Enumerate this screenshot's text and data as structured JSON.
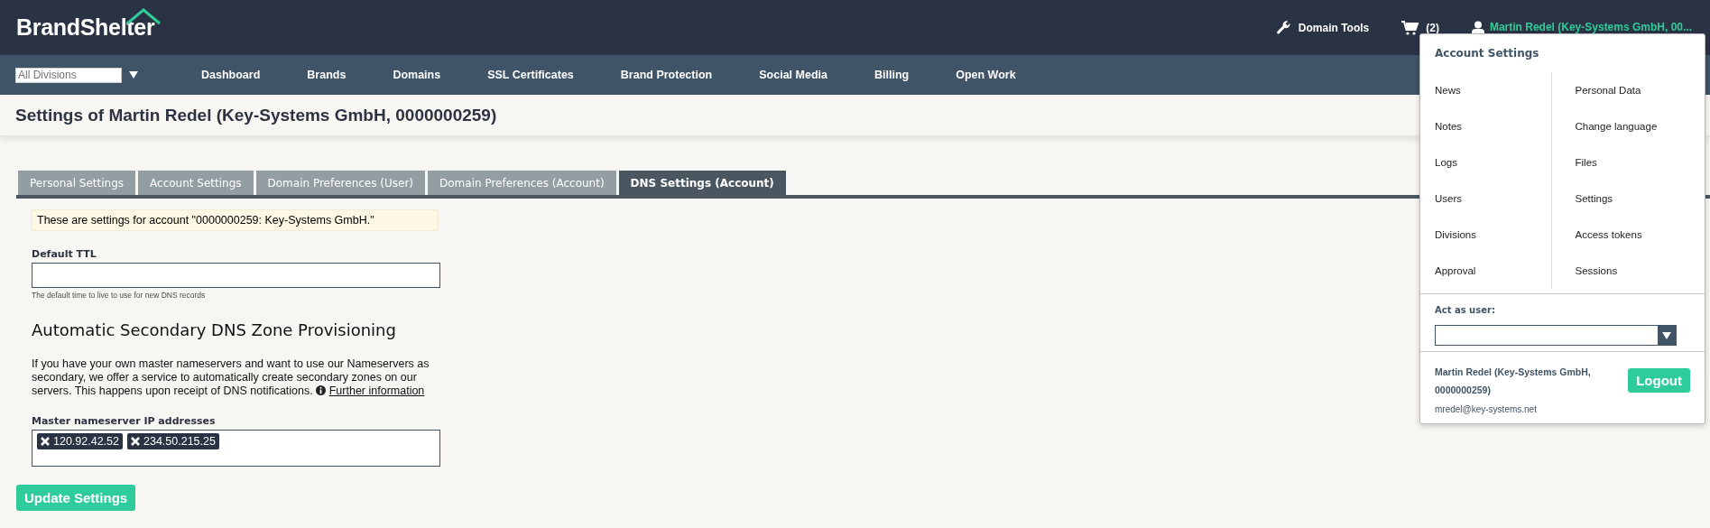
{
  "header": {
    "logo": "BrandShelter",
    "domain_tools": "Domain Tools",
    "cart_count": "(2)",
    "user_name": "Martin Redel (Key-Systems GmbH, 00..."
  },
  "nav": {
    "division_placeholder": "All Divisions",
    "items": [
      "Dashboard",
      "Brands",
      "Domains",
      "SSL Certificates",
      "Brand Protection",
      "Social Media",
      "Billing",
      "Open Work"
    ]
  },
  "page_title": "Settings of Martin Redel (Key-Systems GmbH, 0000000259)",
  "tabs": [
    {
      "label": "Personal Settings",
      "selected": false
    },
    {
      "label": "Account Settings",
      "selected": false
    },
    {
      "label": "Domain Preferences (User)",
      "selected": false
    },
    {
      "label": "Domain Preferences (Account)",
      "selected": false
    },
    {
      "label": "DNS Settings (Account)",
      "selected": true
    }
  ],
  "notice": "These are settings for account \"0000000259: Key-Systems GmbH.\"",
  "default_ttl": {
    "label": "Default TTL",
    "hint": "The default time to live to use for new DNS records"
  },
  "section_heading": "Automatic Secondary DNS Zone Provisioning",
  "description": "If you have your own master nameservers and want to use our Nameservers as secondary, we offer a service to automatically create secondary zones on our servers. This happens upon receipt of DNS notifications.",
  "further_info_link": "Further information",
  "master_nameservers": {
    "label": "Master nameserver IP addresses",
    "ips": [
      "120.92.42.52",
      "234.50.215.25"
    ]
  },
  "update_button": "Update Settings",
  "account_menu": {
    "title": "Account Settings",
    "left_items": [
      "News",
      "Notes",
      "Logs",
      "Users",
      "Divisions",
      "Approval"
    ],
    "right_items": [
      "Personal Data",
      "Change language",
      "Files",
      "Settings",
      "Access tokens",
      "Sessions"
    ],
    "act_as_label": "Act as user:",
    "user_name": "Martin Redel (Key-Systems GmbH, 0000000259)",
    "email": "mredel@key-systems.net",
    "logout": "Logout"
  }
}
